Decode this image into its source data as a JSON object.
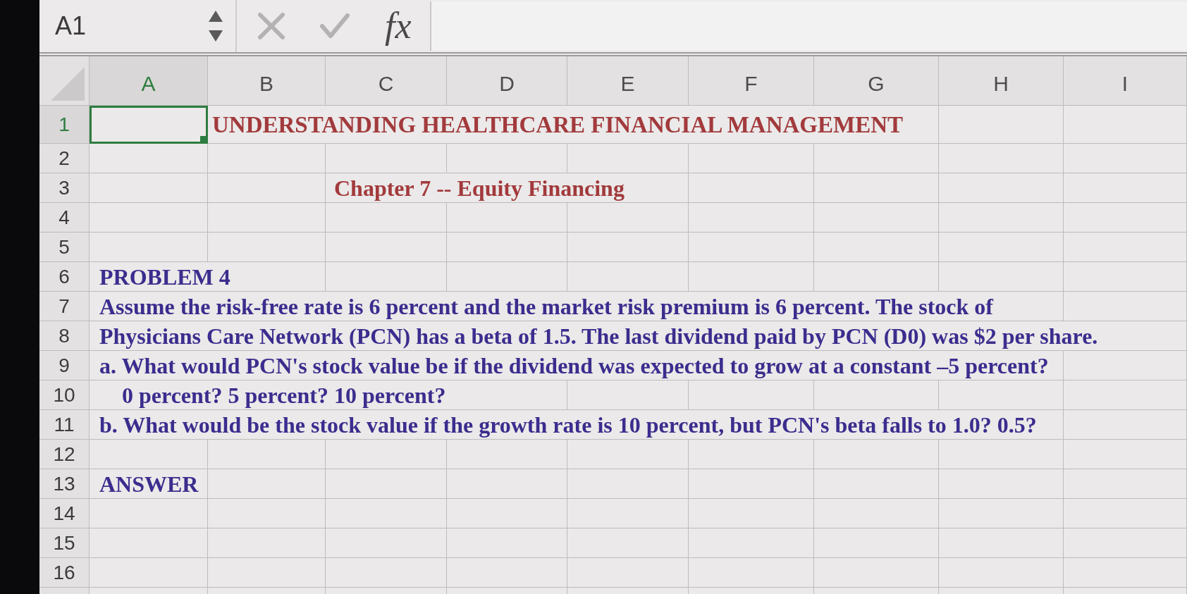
{
  "formula_bar": {
    "name_box": "A1",
    "function_button": "fx"
  },
  "columns": [
    {
      "label": "A",
      "selected": true
    },
    {
      "label": "B",
      "selected": false
    },
    {
      "label": "C",
      "selected": false
    },
    {
      "label": "D",
      "selected": false
    },
    {
      "label": "E",
      "selected": false
    },
    {
      "label": "F",
      "selected": false
    },
    {
      "label": "G",
      "selected": false
    },
    {
      "label": "H",
      "selected": false
    },
    {
      "label": "I",
      "selected": false
    }
  ],
  "rows": [
    {
      "number": "1",
      "selected": true,
      "cells": [
        null,
        {
          "kind": "title",
          "text": "UNDERSTANDING HEALTHCARE FINANCIAL MANAGEMENT"
        }
      ]
    },
    {
      "number": "2",
      "selected": false
    },
    {
      "number": "3",
      "selected": false,
      "cells": [
        null,
        null,
        {
          "kind": "heading",
          "text": "Chapter 7 -- Equity Financing"
        }
      ]
    },
    {
      "number": "4",
      "selected": false
    },
    {
      "number": "5",
      "selected": false
    },
    {
      "number": "6",
      "selected": false,
      "cells": [
        {
          "kind": "body",
          "text": "PROBLEM 4"
        }
      ]
    },
    {
      "number": "7",
      "selected": false,
      "cells": [
        {
          "kind": "body",
          "text": "Assume the risk-free rate is 6 percent and the market risk premium is 6 percent. The stock of"
        }
      ]
    },
    {
      "number": "8",
      "selected": false,
      "cells": [
        {
          "kind": "body",
          "text": "Physicians Care Network (PCN) has a beta of 1.5. The last dividend paid by PCN (D0) was $2 per share."
        }
      ]
    },
    {
      "number": "9",
      "selected": false,
      "cells": [
        {
          "kind": "body",
          "text": "a. What would PCN's stock value be if the dividend was expected to grow at a constant –5 percent?"
        }
      ]
    },
    {
      "number": "10",
      "selected": false,
      "cells": [
        {
          "kind": "continuation",
          "text": "0 percent? 5 percent? 10 percent?"
        }
      ]
    },
    {
      "number": "11",
      "selected": false,
      "cells": [
        {
          "kind": "body",
          "text": "b. What would be the stock value if the growth rate is 10 percent, but PCN's beta falls to 1.0? 0.5?"
        }
      ]
    },
    {
      "number": "12",
      "selected": false
    },
    {
      "number": "13",
      "selected": false,
      "cells": [
        {
          "kind": "body",
          "text": "ANSWER"
        }
      ]
    },
    {
      "number": "14",
      "selected": false
    },
    {
      "number": "15",
      "selected": false
    },
    {
      "number": "16",
      "selected": false
    }
  ]
}
